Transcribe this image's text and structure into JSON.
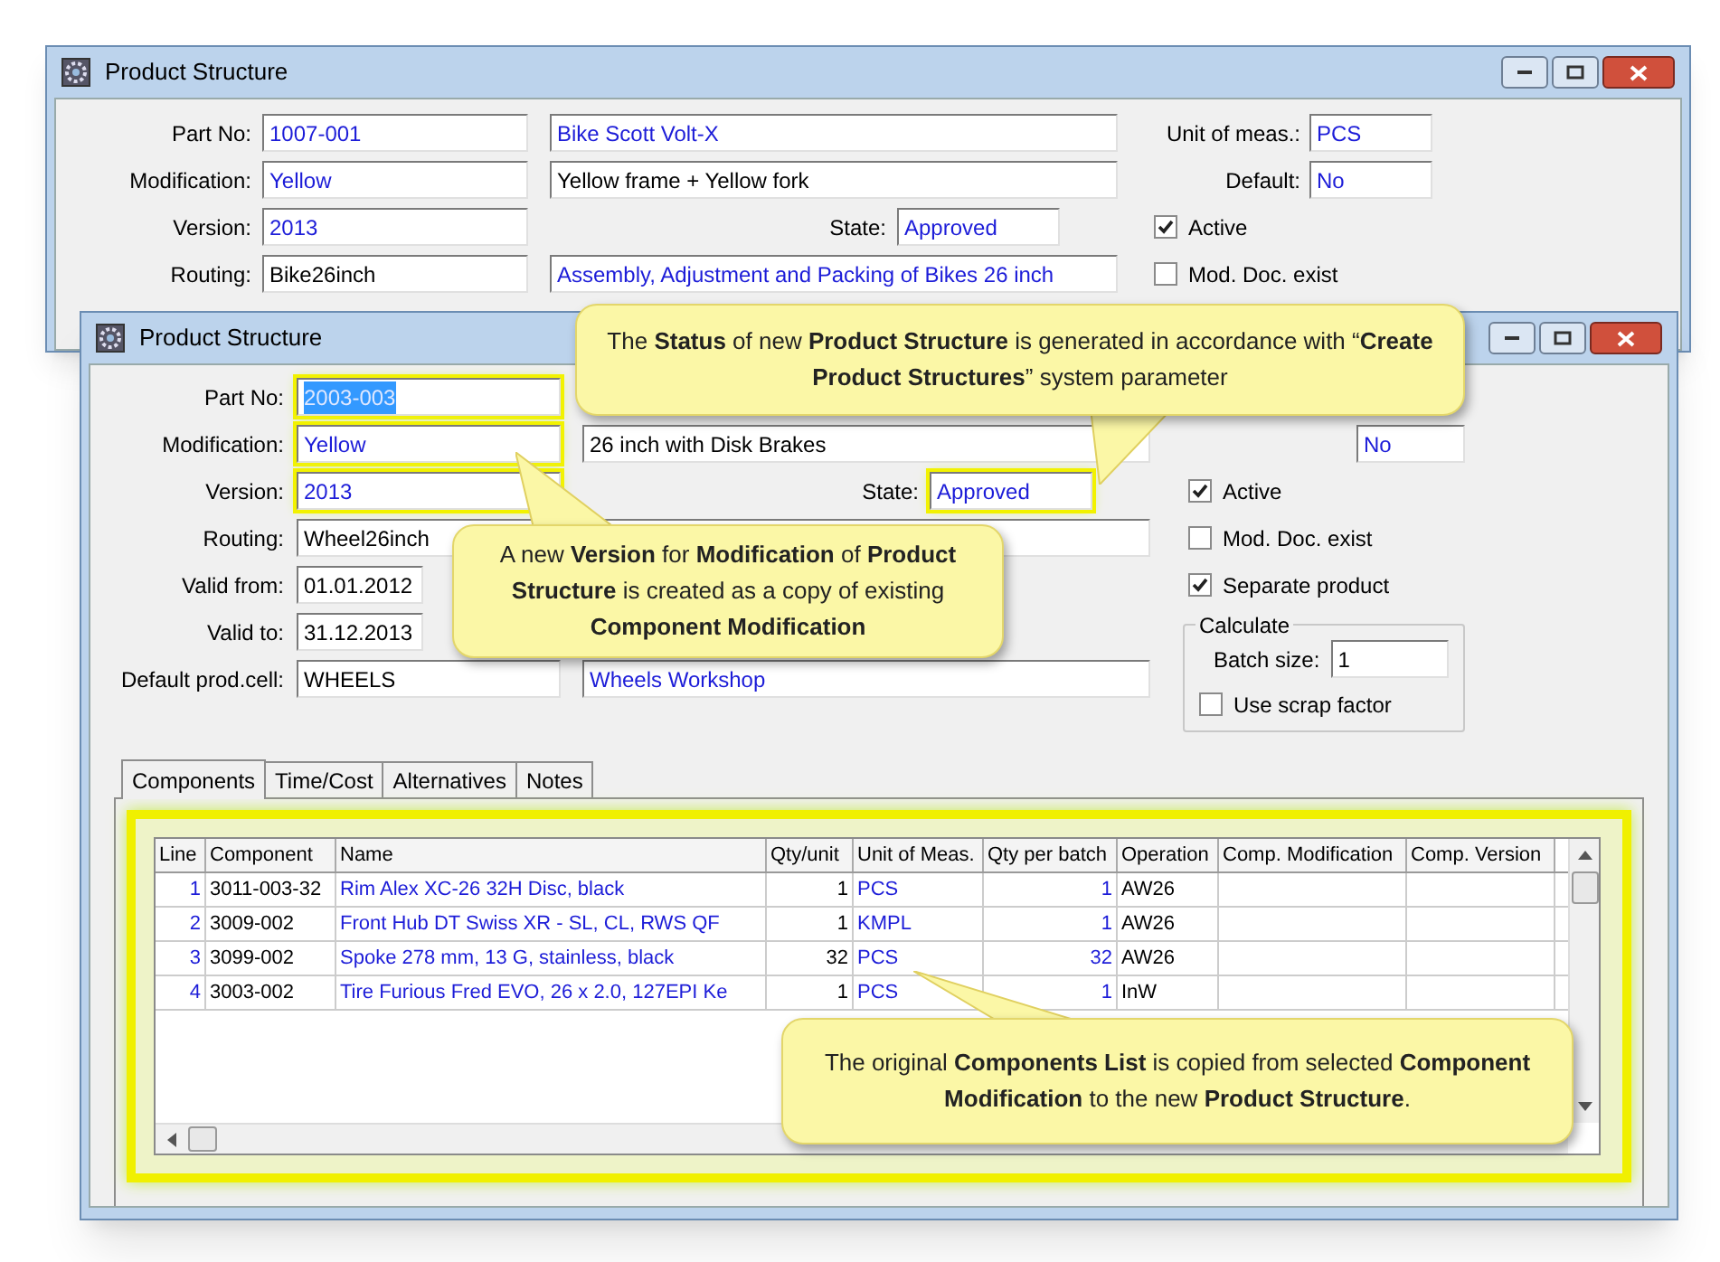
{
  "back_window": {
    "title": "Product Structure",
    "rows": [
      {
        "label": "Part No:",
        "value": "1007-001",
        "linked": true,
        "extra": {
          "kind": "description",
          "value": "Bike Scott Volt-X",
          "linked": true
        }
      },
      {
        "label": "Modification:",
        "value": "Yellow",
        "linked": true,
        "extra": {
          "kind": "description",
          "value": "Yellow frame + Yellow fork",
          "linked": false
        }
      },
      {
        "label": "Version:",
        "value": "2013",
        "linked": true,
        "extra": {
          "kind": "state",
          "label": "State:",
          "value": "Approved",
          "linked": true
        }
      },
      {
        "label": "Routing:",
        "value": "Bike26inch",
        "linked": false,
        "extra": {
          "kind": "description",
          "value": "Assembly, Adjustment and Packing of Bikes 26 inch",
          "linked": true
        }
      }
    ],
    "right": [
      {
        "kind": "field",
        "label": "Unit of meas.:",
        "value": "PCS"
      },
      {
        "kind": "field",
        "label": "Default:",
        "value": "No"
      },
      {
        "kind": "checkbox",
        "label": "Active",
        "checked": true
      },
      {
        "kind": "checkbox",
        "label": "Mod. Doc. exist",
        "checked": false
      }
    ]
  },
  "front_window": {
    "title": "Product Structure",
    "rows": [
      {
        "label": "Part No:",
        "value": "2003-003",
        "linked": true,
        "highlighted": true,
        "text_selected": true,
        "short": false
      },
      {
        "label": "Modification:",
        "value": "Yellow",
        "linked": true,
        "highlighted": true,
        "text_selected": false,
        "short": false,
        "extra": {
          "kind": "description",
          "value": "26 inch with Disk Brakes",
          "linked": false
        }
      },
      {
        "label": "Version:",
        "value": "2013",
        "linked": true,
        "highlighted": true,
        "text_selected": false,
        "short": false,
        "extra": {
          "kind": "state",
          "label": "State:",
          "value": "Approved",
          "linked": true,
          "highlighted": true
        }
      },
      {
        "label": "Routing:",
        "value": "Wheel26inch",
        "linked": false,
        "highlighted": false,
        "text_selected": false,
        "short": false,
        "extra": {
          "kind": "blank"
        }
      },
      {
        "label": "Valid from:",
        "value": "01.01.2012",
        "linked": false,
        "highlighted": false,
        "text_selected": false,
        "short": true
      },
      {
        "label": "Valid to:",
        "value": "31.12.2013",
        "linked": false,
        "highlighted": false,
        "text_selected": false,
        "short": true
      },
      {
        "label": "Default prod.cell:",
        "value": "WHEELS",
        "linked": false,
        "highlighted": false,
        "text_selected": false,
        "short": false,
        "extra": {
          "kind": "description",
          "value": "Wheels Workshop",
          "linked": true
        }
      }
    ],
    "default_value": "No",
    "checkboxes": [
      {
        "label": "Active",
        "checked": true
      },
      {
        "label": "Mod. Doc. exist",
        "checked": false
      },
      {
        "label": "Separate product",
        "checked": true
      }
    ],
    "calculate": {
      "title": "Calculate",
      "batch_label": "Batch size:",
      "batch_value": "1",
      "scrap": {
        "label": "Use scrap factor",
        "checked": false
      }
    },
    "tabs": [
      {
        "label": "Components",
        "selected": true
      },
      {
        "label": "Time/Cost",
        "selected": false
      },
      {
        "label": "Alternatives",
        "selected": false
      },
      {
        "label": "Notes",
        "selected": false
      }
    ],
    "table": {
      "highlighted": true,
      "columns": [
        "Line",
        "Component",
        "Name",
        "Qty/unit",
        "Unit of Meas.",
        "Qty per batch",
        "Operation",
        "Comp. Modification",
        "Comp. Version"
      ],
      "rows": [
        [
          "1",
          "3011-003-32",
          "Rim Alex XC-26 32H Disc, black",
          "1",
          "PCS",
          "1",
          "AW26"
        ],
        [
          "2",
          "3009-002",
          "Front Hub DT Swiss XR - SL, CL, RWS QF",
          "1",
          "KMPL",
          "1",
          "AW26"
        ],
        [
          "3",
          "3099-002",
          "Spoke 278 mm, 13 G, stainless, black",
          "32",
          "PCS",
          "32",
          "AW26"
        ],
        [
          "4",
          "3003-002",
          "Tire Furious Fred EVO, 26 x 2.0, 127EPI Ke",
          "1",
          "PCS",
          "1",
          "InW"
        ]
      ]
    }
  },
  "callouts": [
    {
      "text": "The **Status** of new **Product Structure** is generated in accordance with “**Create Product Structures**” system parameter"
    },
    {
      "text": "A new **Version** for **Modification** of **Product Structure** is created as a copy of existing **Component Modification**"
    },
    {
      "text": "The original **Components List** is copied from selected **Component Modification** to the new **Product Structure**."
    }
  ]
}
